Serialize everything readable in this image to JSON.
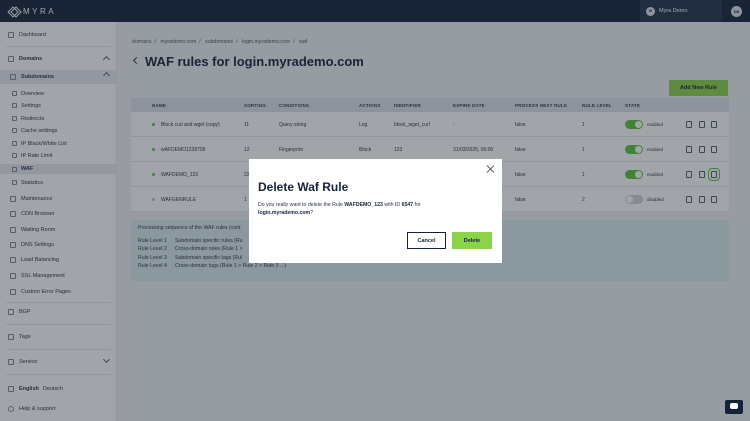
{
  "app": {
    "logo_text": "MYRA"
  },
  "user": {
    "avatar_initials": "M",
    "name": "Myra Demo",
    "account_initials": "DB"
  },
  "sidebar": {
    "dashboard": "Dashboard",
    "domains": "Domains",
    "subdomains": "Subdomains",
    "sub_items": [
      "Overview",
      "Settings",
      "Redirects",
      "Cache settings",
      "IP Black/White List",
      "IP Rate Limit",
      "WAF",
      "Statistics",
      "Maintenance",
      "CDN Browser",
      "Waiting Room",
      "DNS Settings",
      "Load Balancing",
      "SSL Management",
      "Custom Error Pages"
    ],
    "bgp": "BGP",
    "tags": "Tags",
    "service": "Service",
    "lang_active": "English",
    "lang_other": "Deutsch",
    "help": "Help & support"
  },
  "breadcrumb": [
    "domains",
    "myrademo.com",
    "subdomains",
    "login.myrademo.com",
    "waf"
  ],
  "page_title": "WAF rules for login.myrademo.com",
  "add_button": "Add New Rule",
  "table": {
    "headers": [
      "NAME",
      "SORTING",
      "CONDITIONS",
      "ACTIONS",
      "IDENTIFIER",
      "EXPIRE DATE",
      "PROCESS NEXT RULE",
      "RULE LEVEL",
      "STATE"
    ],
    "rows": [
      {
        "name": "Block curl and wget (copy)",
        "sorting": "11",
        "conditions": "Query string",
        "actions": "Log",
        "identifier": "block_wget_curl",
        "expire": "-",
        "next": "false",
        "level": "1",
        "state": "enabled",
        "active": true
      },
      {
        "name": "wAFDEMO1238799",
        "sorting": "12",
        "conditions": "Fingerprint",
        "actions": "Block",
        "identifier": "123",
        "expire": "31/03/2025, 00:00",
        "next": "false",
        "level": "1",
        "state": "enabled",
        "active": true
      },
      {
        "name": "WAFDEMO_123",
        "sorting": "22",
        "conditions": "",
        "actions": "",
        "identifier": "",
        "expire": "",
        "next": "false",
        "level": "1",
        "state": "enabled",
        "active": true
      },
      {
        "name": "WAFGENRULE",
        "sorting": "1",
        "conditions": "",
        "actions": "",
        "identifier": "",
        "expire": "",
        "next": "false",
        "level": "2",
        "state": "disabled",
        "active": false
      }
    ]
  },
  "info": {
    "title": "Processing sequence of the WAF rules (cont",
    "levels": [
      {
        "level": "Rule Level 1",
        "desc": "Subdomain specific rules (Ru"
      },
      {
        "level": "Rule Level 2",
        "desc": "Cross-domain rules (Rule 1 >"
      },
      {
        "level": "Rule Level 3",
        "desc": "Subdomain specific tags (Rul"
      },
      {
        "level": "Rule Level 4",
        "desc": "Cross-domain tags (Rule 1 > Rule 2 > Rule 3 ...)"
      }
    ]
  },
  "modal": {
    "title": "Delete Waf Rule",
    "text_1": "Do you really want to delete the Rule",
    "rule_name": "WAFDEMO_123",
    "text_2": "with ID",
    "rule_id": "6547",
    "text_3": "for",
    "domain": "login.myrademo.com",
    "text_4": "?",
    "cancel": "Cancel",
    "delete": "Delete"
  },
  "colors": {
    "accent": "#8bd44a",
    "navy": "#15233a",
    "enabled": "#5cc43d"
  }
}
